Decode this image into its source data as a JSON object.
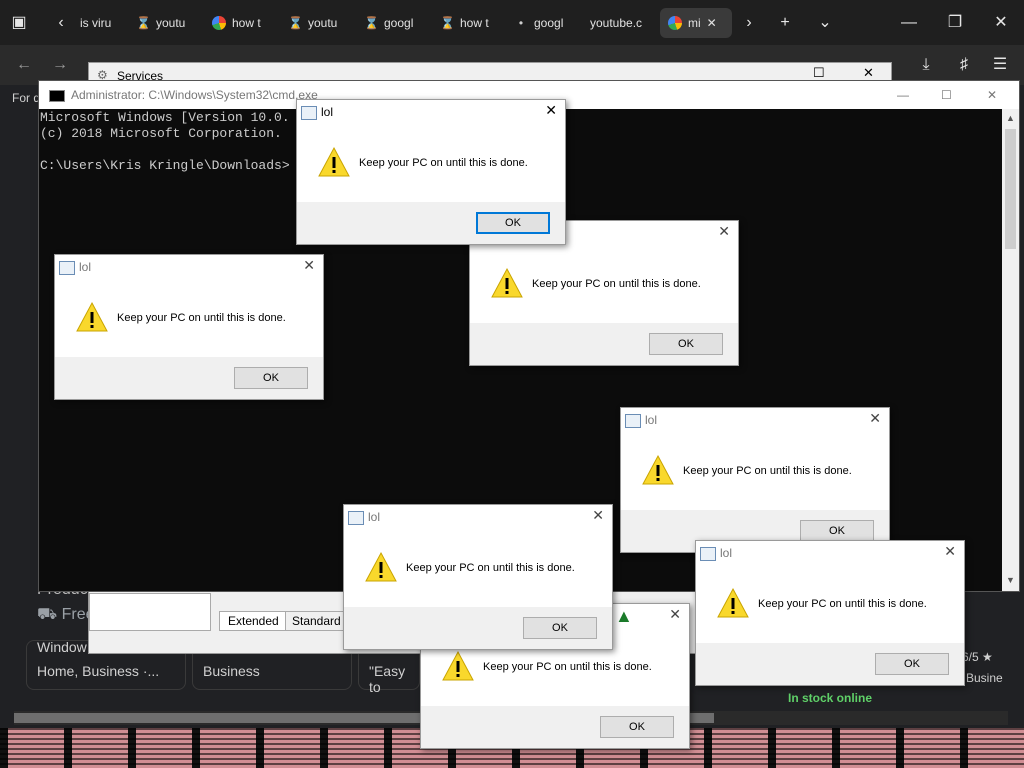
{
  "browser": {
    "tabs": [
      {
        "label": "is viru",
        "icon": "page-icon"
      },
      {
        "label": "youtu",
        "icon": "hourglass-icon"
      },
      {
        "label": "how t",
        "icon": "google-icon"
      },
      {
        "label": "youtu",
        "icon": "hourglass-icon"
      },
      {
        "label": "googl",
        "icon": "hourglass-icon"
      },
      {
        "label": "how t",
        "icon": "hourglass-icon"
      },
      {
        "label": "googl",
        "icon": "dot-icon"
      },
      {
        "label": "youtube.c",
        "icon": "none"
      },
      {
        "label": "mi",
        "icon": "google-icon"
      }
    ],
    "page_left_text": "For q",
    "page_products": "Produc",
    "page_free": "Free",
    "page_windows": "Window",
    "card1": "Home, Business ·...",
    "card2": "Business",
    "card3": "\"Easy to",
    "rating": "6/5 ★",
    "business": "Busine",
    "stock": "In stock online"
  },
  "services": {
    "title": "Services",
    "tab_extended": "Extended",
    "tab_standard": "Standard"
  },
  "cmd": {
    "title": "Administrator: C:\\Windows\\System32\\cmd.exe",
    "line1": "Microsoft Windows [Version 10.0.",
    "line2": "(c) 2018 Microsoft Corporation.",
    "line3": "C:\\Users\\Kris Kringle\\Downloads>"
  },
  "dialog": {
    "title": "lol",
    "message": "Keep your PC on until this is done.",
    "ok": "OK"
  }
}
